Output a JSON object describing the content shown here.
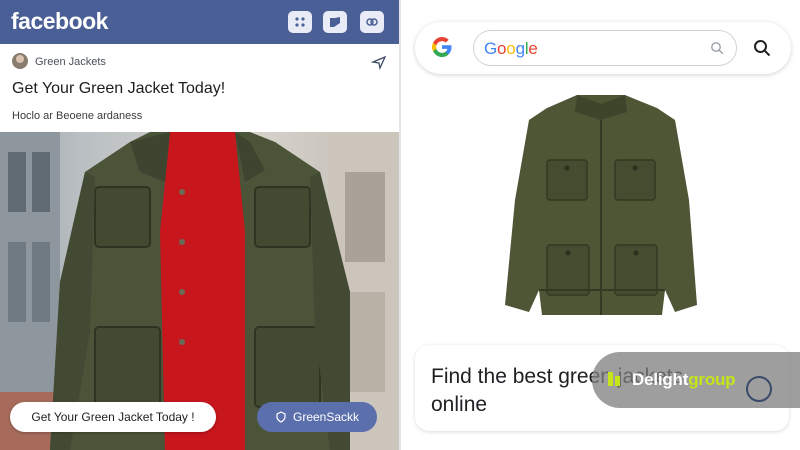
{
  "facebook": {
    "logo": "facebook",
    "post": {
      "page_name": "Green Jackets",
      "title": "Get Your Green Jacket Today!",
      "subtitle": "Hoclo ar Beoene ardaness",
      "cta_label": "Get Your Green Jacket Today !",
      "brand_pill_label": "GreenSackk"
    },
    "colors": {
      "bar": "#4a5f96",
      "brand_pill": "#5c6fad"
    }
  },
  "google": {
    "search_value": "Google",
    "caption": "Find the best green jackets online",
    "colors": {
      "blue": "#4285F4",
      "red": "#EA4335",
      "yellow": "#FBBC05",
      "green": "#34A853"
    }
  },
  "watermark": {
    "text_main": "Delight",
    "text_accent": "group",
    "accent_color": "#c6e41a"
  }
}
